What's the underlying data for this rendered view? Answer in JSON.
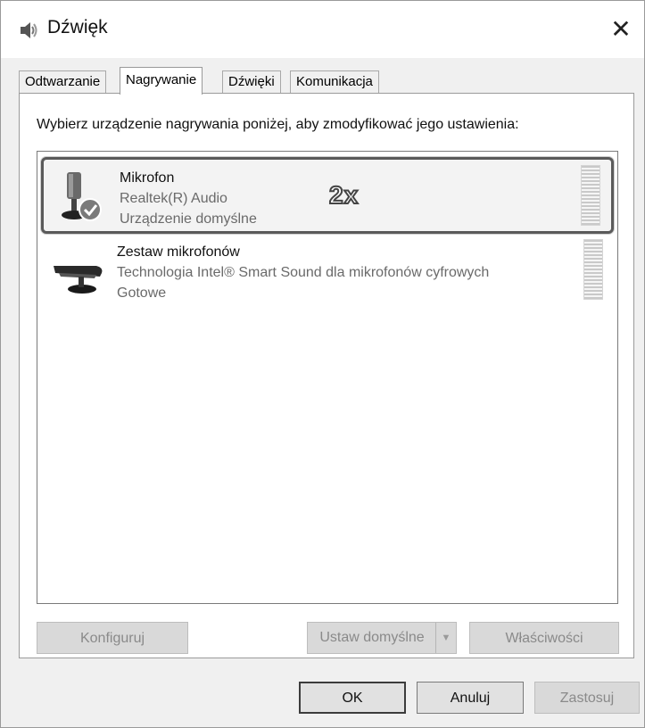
{
  "window": {
    "title": "Dźwięk",
    "close_glyph": "✕"
  },
  "tabs": [
    {
      "label": "Odtwarzanie"
    },
    {
      "label": "Nagrywanie"
    },
    {
      "label": "Dźwięki"
    },
    {
      "label": "Komunikacja"
    }
  ],
  "active_tab": "Nagrywanie",
  "panel": {
    "instruction": "Wybierz urządzenie nagrywania poniżej, aby zmodyfikować jego ustawienia:"
  },
  "devices": [
    {
      "name": "Mikrofon",
      "driver": "Realtek(R) Audio",
      "status": "Urządzenie domyślne",
      "icon": "microphone-icon",
      "selected": true,
      "annotation": "2x"
    },
    {
      "name": "Zestaw mikrofonów",
      "driver": "Technologia Intel® Smart Sound dla mikrofonów cyfrowych",
      "status": "Gotowe",
      "icon": "microphone-array-icon",
      "selected": false
    }
  ],
  "panel_buttons": {
    "configure": "Konfiguruj",
    "set_default": "Ustaw domyślne",
    "properties": "Właściwości"
  },
  "dialog_buttons": {
    "ok": "OK",
    "cancel": "Anuluj",
    "apply": "Zastosuj"
  },
  "colors": {
    "selection_border": "#5a5a5a",
    "disabled_text": "#8a8a8a"
  }
}
